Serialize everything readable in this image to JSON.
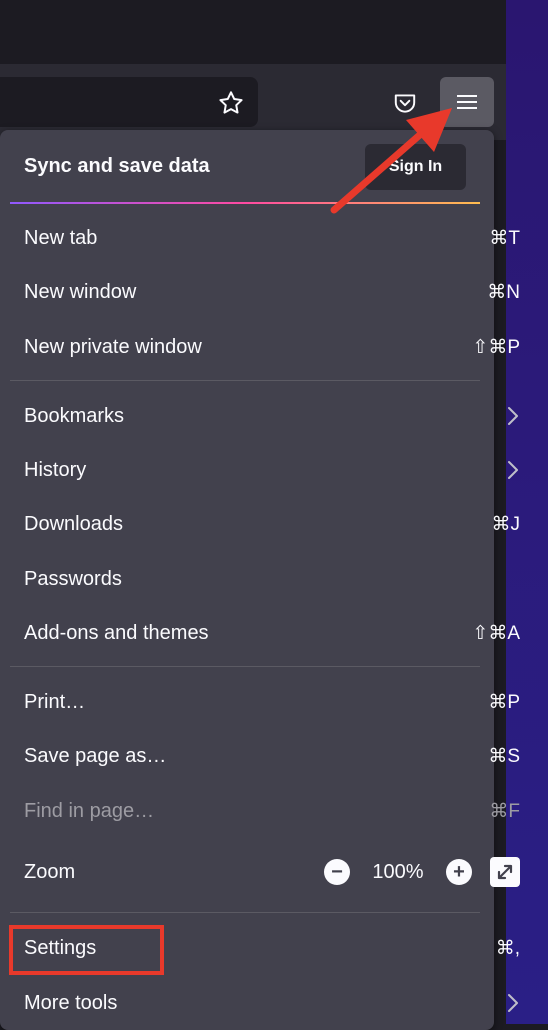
{
  "toolbar": {
    "star_icon": "star-icon",
    "pocket_icon": "pocket-icon",
    "menu_icon": "hamburger-menu-icon"
  },
  "menu": {
    "sync_title": "Sync and save data",
    "sign_in_label": "Sign In",
    "items": [
      {
        "label": "New tab",
        "shortcut": "⌘T"
      },
      {
        "label": "New window",
        "shortcut": "⌘N"
      },
      {
        "label": "New private window",
        "shortcut": "⇧⌘P"
      },
      {
        "label": "Bookmarks",
        "submenu": true
      },
      {
        "label": "History",
        "submenu": true
      },
      {
        "label": "Downloads",
        "shortcut": "⌘J"
      },
      {
        "label": "Passwords",
        "shortcut": ""
      },
      {
        "label": "Add-ons and themes",
        "shortcut": "⇧⌘A"
      },
      {
        "label": "Print…",
        "shortcut": "⌘P"
      },
      {
        "label": "Save page as…",
        "shortcut": "⌘S"
      },
      {
        "label": "Find in page…",
        "shortcut": "⌘F",
        "disabled": true
      },
      {
        "label": "Zoom",
        "zoom_value": "100%",
        "zoom_out": "−",
        "zoom_in": "+"
      },
      {
        "label": "Settings",
        "shortcut": "⌘,"
      },
      {
        "label": "More tools",
        "submenu": true
      }
    ]
  },
  "annotations": {
    "arrow_color": "#e8392b",
    "highlight_color": "#e8392b"
  }
}
